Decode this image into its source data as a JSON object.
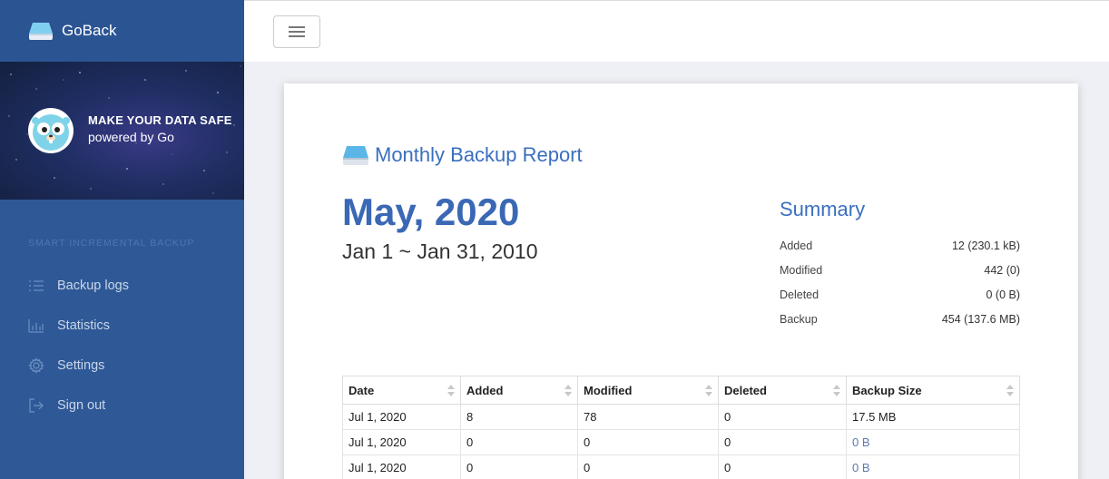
{
  "app": {
    "name": "GoBack"
  },
  "hero": {
    "headline": "MAKE YOUR DATA SAFE",
    "subline": "powered by Go"
  },
  "menu": {
    "section": "SMART INCREMENTAL BACKUP",
    "items": [
      {
        "label": "Backup logs",
        "icon": "list-icon"
      },
      {
        "label": "Statistics",
        "icon": "bar-chart-icon"
      },
      {
        "label": "Settings",
        "icon": "gear-icon"
      },
      {
        "label": "Sign out",
        "icon": "sign-out-icon"
      }
    ]
  },
  "report": {
    "title": "Monthly Backup Report",
    "month": "May, 2020",
    "range": "Jan 1 ~ Jan 31, 2010"
  },
  "summary": {
    "title": "Summary",
    "rows": [
      {
        "label": "Added",
        "value": "12 (230.1 kB)"
      },
      {
        "label": "Modified",
        "value": "442 (0)"
      },
      {
        "label": "Deleted",
        "value": "0 (0 B)"
      },
      {
        "label": "Backup",
        "value": "454 (137.6 MB)"
      }
    ]
  },
  "table": {
    "headers": [
      "Date",
      "Added",
      "Modified",
      "Deleted",
      "Backup Size"
    ],
    "rows": [
      [
        "Jul 1, 2020",
        "8",
        "78",
        "0",
        "17.5 MB"
      ],
      [
        "Jul 1, 2020",
        "0",
        "0",
        "0",
        "0 B"
      ],
      [
        "Jul 1, 2020",
        "0",
        "0",
        "0",
        "0 B"
      ]
    ]
  },
  "colors": {
    "sidebar": "#2f5996",
    "accent": "#3a6fbe"
  }
}
